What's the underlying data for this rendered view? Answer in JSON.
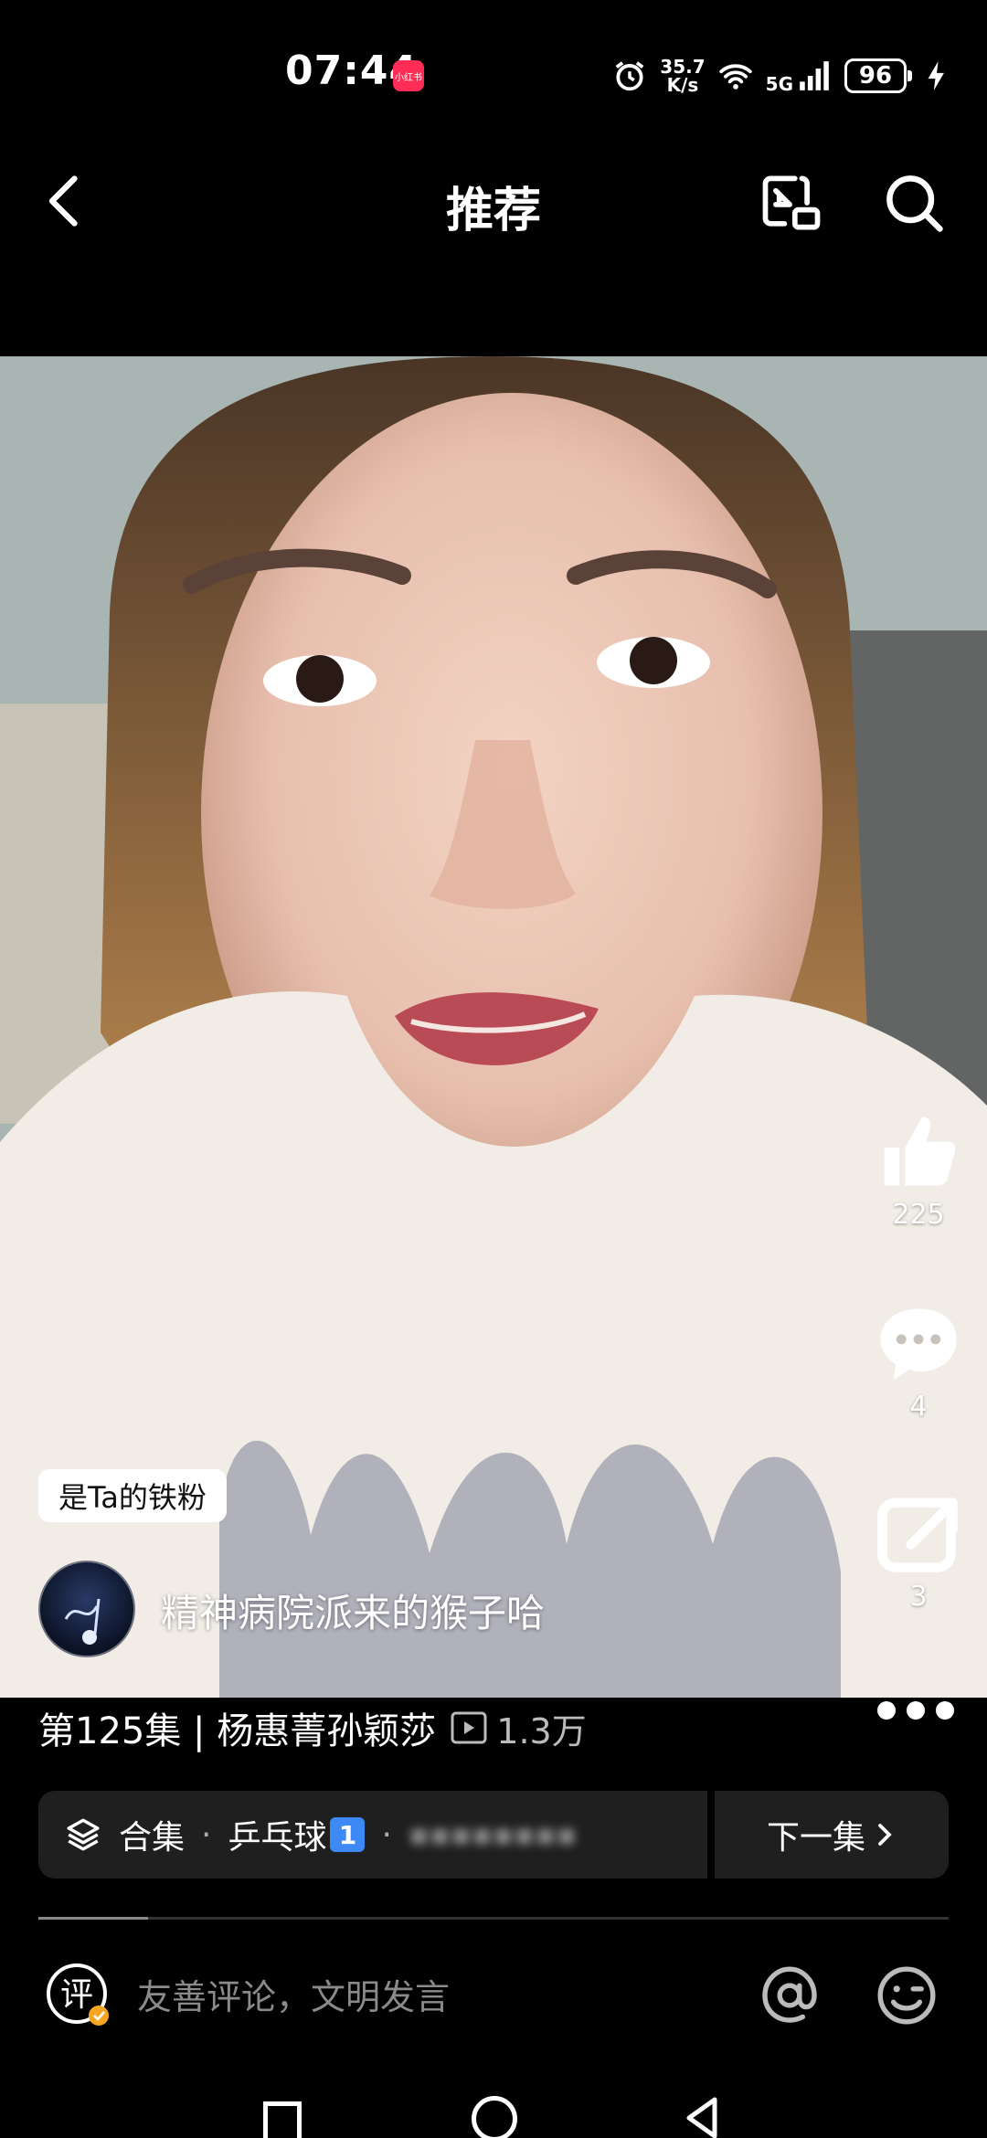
{
  "status_bar": {
    "time": "07:44",
    "notification_badge": "小红书",
    "net_speed_value": "35.7",
    "net_speed_unit": "K/s",
    "signal_label": "5G",
    "battery": "96"
  },
  "nav": {
    "title": "推荐"
  },
  "video": {
    "author_name": "精神病院派来的猴子哈",
    "fan_tag": "是Ta的铁粉"
  },
  "actions": {
    "likes": "225",
    "comments": "4",
    "shares": "3"
  },
  "episode": {
    "title": "第125集 | 杨惠菁孙颖莎",
    "play_count": "1.3万"
  },
  "collection": {
    "label": "合集",
    "separator": "·",
    "category": "乒乓球",
    "rank": "1",
    "blurred": "▪▪▪▪▪▪▪▪"
  },
  "next_episode_label": "下一集",
  "progress": 0.12,
  "comment_bar": {
    "placeholder": "友善评论，文明发言",
    "review_glyph": "评"
  },
  "colors": {
    "background": "#000000",
    "rank_badge": "#3d8af7",
    "verified": "#f5a623"
  }
}
